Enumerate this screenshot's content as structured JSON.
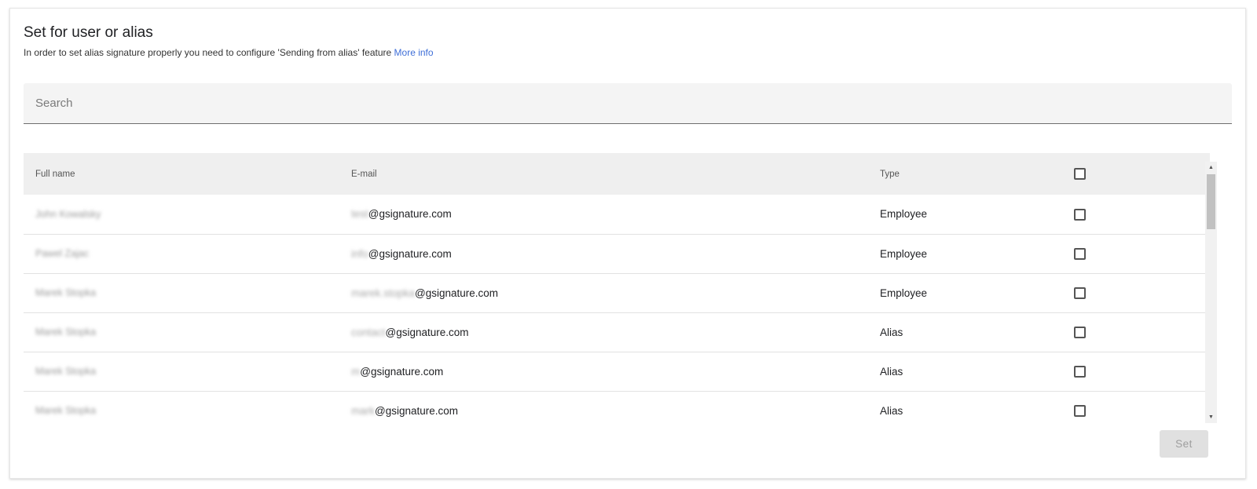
{
  "header": {
    "title": "Set for user or alias",
    "subtitle": "In order to set alias signature properly you need to configure 'Sending from alias' feature",
    "more_info_link": "More info"
  },
  "search": {
    "placeholder": "Search",
    "value": ""
  },
  "table": {
    "columns": [
      "Full name",
      "E-mail",
      "Type",
      ""
    ],
    "rows": [
      {
        "name": "John Kowalsky",
        "email_local": "test",
        "email_domain": "@gsignature.com",
        "type": "Employee",
        "checked": false
      },
      {
        "name": "Pawel Zajac",
        "email_local": "info",
        "email_domain": "@gsignature.com",
        "type": "Employee",
        "checked": false
      },
      {
        "name": "Marek Stopka",
        "email_local": "marek.stopka",
        "email_domain": "@gsignature.com",
        "type": "Employee",
        "checked": false
      },
      {
        "name": "Marek Stopka",
        "email_local": "contact",
        "email_domain": "@gsignature.com",
        "type": "Alias",
        "checked": false
      },
      {
        "name": "Marek Stopka",
        "email_local": "m",
        "email_domain": "@gsignature.com",
        "type": "Alias",
        "checked": false
      },
      {
        "name": "Marek Stopka",
        "email_local": "mark",
        "email_domain": "@gsignature.com",
        "type": "Alias",
        "checked": false
      }
    ]
  },
  "actions": {
    "set_label": "Set"
  },
  "colors": {
    "link": "#3f6fd8",
    "header_bg": "#efefef",
    "search_bg": "#f4f4f4",
    "button_disabled_bg": "#e0e0e0"
  }
}
